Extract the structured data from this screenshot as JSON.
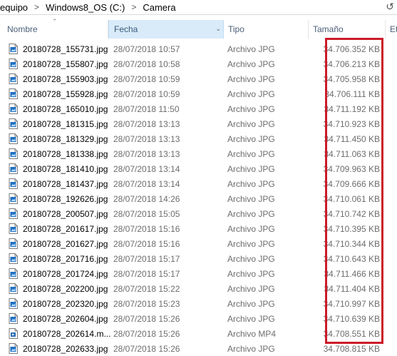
{
  "address": {
    "crumbs": [
      "equipo",
      "Windows8_OS (C:)",
      "Camera"
    ],
    "separator": ">"
  },
  "columns": {
    "nombre": "Nombre",
    "fecha": "Fecha",
    "tipo": "Tipo",
    "tamano": "Tamaño",
    "etiquetas": "Et"
  },
  "files": [
    {
      "name": "20180728_155731.jpg",
      "date": "28/07/2018 10:57",
      "type": "Archivo JPG",
      "size": "34.706.352 KB",
      "icon": "jpg-file-icon"
    },
    {
      "name": "20180728_155807.jpg",
      "date": "28/07/2018 10:58",
      "type": "Archivo JPG",
      "size": "34.706.213 KB",
      "icon": "jpg-file-icon"
    },
    {
      "name": "20180728_155903.jpg",
      "date": "28/07/2018 10:59",
      "type": "Archivo JPG",
      "size": "34.705.958 KB",
      "icon": "jpg-file-icon"
    },
    {
      "name": "20180728_155928.jpg",
      "date": "28/07/2018 10:59",
      "type": "Archivo JPG",
      "size": "34.706.111 KB",
      "icon": "jpg-file-icon"
    },
    {
      "name": "20180728_165010.jpg",
      "date": "28/07/2018 11:50",
      "type": "Archivo JPG",
      "size": "34.711.192 KB",
      "icon": "jpg-file-icon"
    },
    {
      "name": "20180728_181315.jpg",
      "date": "28/07/2018 13:13",
      "type": "Archivo JPG",
      "size": "34.710.923 KB",
      "icon": "jpg-file-icon"
    },
    {
      "name": "20180728_181329.jpg",
      "date": "28/07/2018 13:13",
      "type": "Archivo JPG",
      "size": "34.711.450 KB",
      "icon": "jpg-file-icon"
    },
    {
      "name": "20180728_181338.jpg",
      "date": "28/07/2018 13:13",
      "type": "Archivo JPG",
      "size": "34.711.063 KB",
      "icon": "jpg-file-icon"
    },
    {
      "name": "20180728_181410.jpg",
      "date": "28/07/2018 13:14",
      "type": "Archivo JPG",
      "size": "34.709.963 KB",
      "icon": "jpg-file-icon"
    },
    {
      "name": "20180728_181437.jpg",
      "date": "28/07/2018 13:14",
      "type": "Archivo JPG",
      "size": "34.709.666 KB",
      "icon": "jpg-file-icon"
    },
    {
      "name": "20180728_192626.jpg",
      "date": "28/07/2018 14:26",
      "type": "Archivo JPG",
      "size": "34.710.061 KB",
      "icon": "jpg-file-icon"
    },
    {
      "name": "20180728_200507.jpg",
      "date": "28/07/2018 15:05",
      "type": "Archivo JPG",
      "size": "34.710.742 KB",
      "icon": "jpg-file-icon"
    },
    {
      "name": "20180728_201617.jpg",
      "date": "28/07/2018 15:16",
      "type": "Archivo JPG",
      "size": "34.710.395 KB",
      "icon": "jpg-file-icon"
    },
    {
      "name": "20180728_201627.jpg",
      "date": "28/07/2018 15:16",
      "type": "Archivo JPG",
      "size": "34.710.344 KB",
      "icon": "jpg-file-icon"
    },
    {
      "name": "20180728_201716.jpg",
      "date": "28/07/2018 15:17",
      "type": "Archivo JPG",
      "size": "34.710.643 KB",
      "icon": "jpg-file-icon"
    },
    {
      "name": "20180728_201724.jpg",
      "date": "28/07/2018 15:17",
      "type": "Archivo JPG",
      "size": "34.711.466 KB",
      "icon": "jpg-file-icon"
    },
    {
      "name": "20180728_202200.jpg",
      "date": "28/07/2018 15:22",
      "type": "Archivo JPG",
      "size": "34.711.404 KB",
      "icon": "jpg-file-icon"
    },
    {
      "name": "20180728_202320.jpg",
      "date": "28/07/2018 15:23",
      "type": "Archivo JPG",
      "size": "34.710.997 KB",
      "icon": "jpg-file-icon"
    },
    {
      "name": "20180728_202604.jpg",
      "date": "28/07/2018 15:26",
      "type": "Archivo JPG",
      "size": "34.710.639 KB",
      "icon": "jpg-file-icon"
    },
    {
      "name": "20180728_202614.m...",
      "date": "28/07/2018 15:26",
      "type": "Archivo MP4",
      "size": "34.708.551 KB",
      "icon": "mp4-file-icon"
    },
    {
      "name": "20180728_202633.jpg",
      "date": "28/07/2018 15:26",
      "type": "Archivo JPG",
      "size": "34.708.815 KB",
      "icon": "jpg-file-icon"
    }
  ],
  "colors": {
    "highlight": "#cc1b2a",
    "sorted_header_bg": "#d9ebf9",
    "header_text": "#4c607a",
    "secondary_text": "#6d6d6d"
  }
}
